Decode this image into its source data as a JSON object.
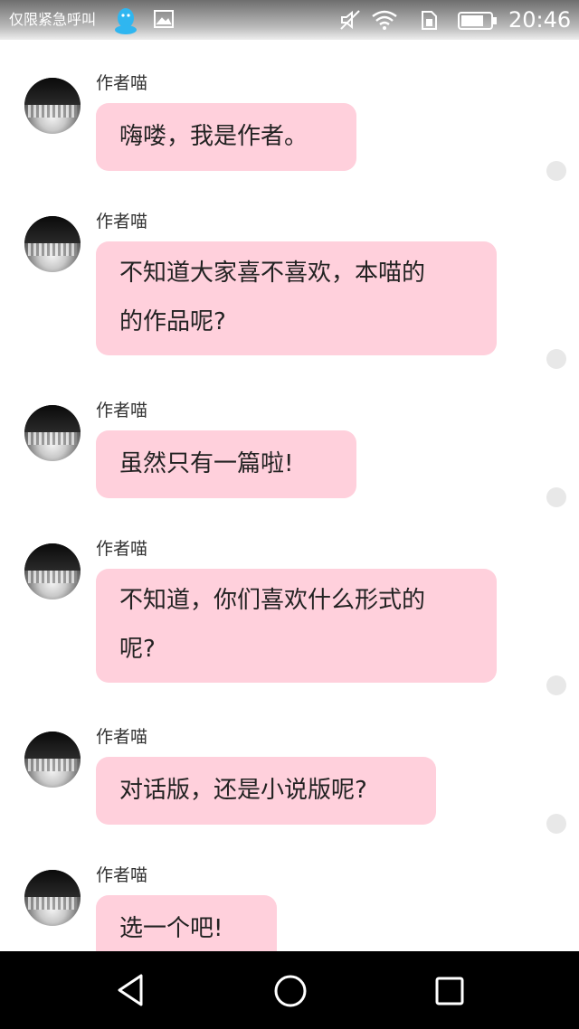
{
  "status_bar": {
    "carrier": "仅限紧急呼叫",
    "time": "20:46",
    "icons": [
      "qq-icon",
      "image-icon",
      "mute-icon",
      "wifi-icon",
      "sim-icon",
      "battery-icon"
    ]
  },
  "chat": {
    "bubble_color": "#ffd0dc",
    "messages": [
      {
        "sender": "作者喵",
        "lines": [
          "嗨喽，我是作者。"
        ]
      },
      {
        "sender": "作者喵",
        "lines": [
          "不知道大家喜不喜欢，本喵的",
          "的作品呢?"
        ]
      },
      {
        "sender": "作者喵",
        "lines": [
          "虽然只有一篇啦!"
        ]
      },
      {
        "sender": "作者喵",
        "lines": [
          "不知道，你们喜欢什么形式的",
          "呢?"
        ]
      },
      {
        "sender": "作者喵",
        "lines": [
          "对话版，还是小说版呢?"
        ]
      },
      {
        "sender": "作者喵",
        "lines": [
          "选一个吧!"
        ]
      }
    ]
  },
  "nav_bar": {
    "buttons": [
      "back-icon",
      "home-icon",
      "recents-icon"
    ]
  }
}
